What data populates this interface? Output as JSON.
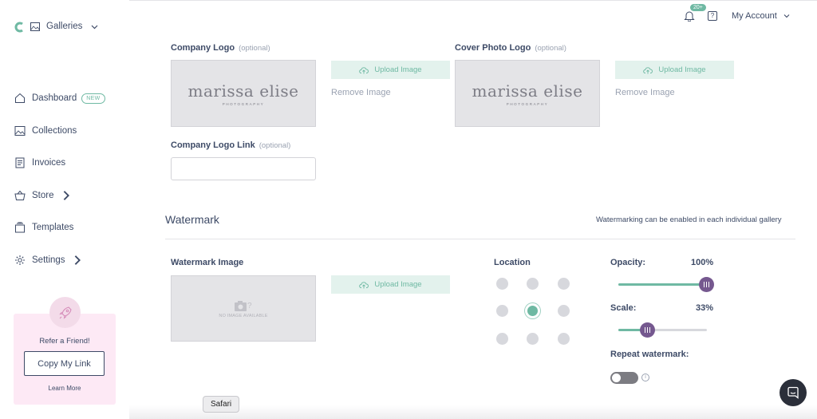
{
  "sidebar": {
    "gallery_selector": "Galleries",
    "items": [
      {
        "label": "Dashboard",
        "badge": "NEW"
      },
      {
        "label": "Collections"
      },
      {
        "label": "Invoices"
      },
      {
        "label": "Store"
      },
      {
        "label": "Templates"
      },
      {
        "label": "Settings"
      }
    ],
    "refer": {
      "title": "Refer a Friend!",
      "button": "Copy My Link",
      "link": "Learn More"
    }
  },
  "topbar": {
    "notification_count": "20+",
    "help": "?",
    "account": "My Account"
  },
  "branding": {
    "company_logo": {
      "label": "Company Logo",
      "optional": "(optional)",
      "logo_text": "marissa elise",
      "logo_sub": "PHOTOGRAPHY",
      "upload": "Upload Image",
      "remove": "Remove Image"
    },
    "cover_logo": {
      "label": "Cover Photo Logo",
      "optional": "(optional)",
      "logo_text": "marissa elise",
      "logo_sub": "PHOTOGRAPHY",
      "upload": "Upload Image",
      "remove": "Remove Image"
    },
    "logo_link": {
      "label": "Company Logo Link",
      "optional": "(optional)",
      "value": ""
    }
  },
  "watermark": {
    "title": "Watermark",
    "note": "Watermarking can be enabled in each individual gallery",
    "image_label": "Watermark Image",
    "no_image": "NO IMAGE AVAILABLE",
    "upload": "Upload Image",
    "location_label": "Location",
    "location_selected": "center",
    "opacity": {
      "label": "Opacity:",
      "value_text": "100%",
      "value": 100
    },
    "scale": {
      "label": "Scale:",
      "value_text": "33%",
      "value": 33
    },
    "repeat": {
      "label": "Repeat watermark:",
      "enabled": false
    }
  },
  "tooltip": "Safari",
  "colors": {
    "accent": "#6fb9a3",
    "slider_thumb": "#75588f",
    "text": "#3d4a66",
    "refer_bg": "#fde9f5"
  }
}
